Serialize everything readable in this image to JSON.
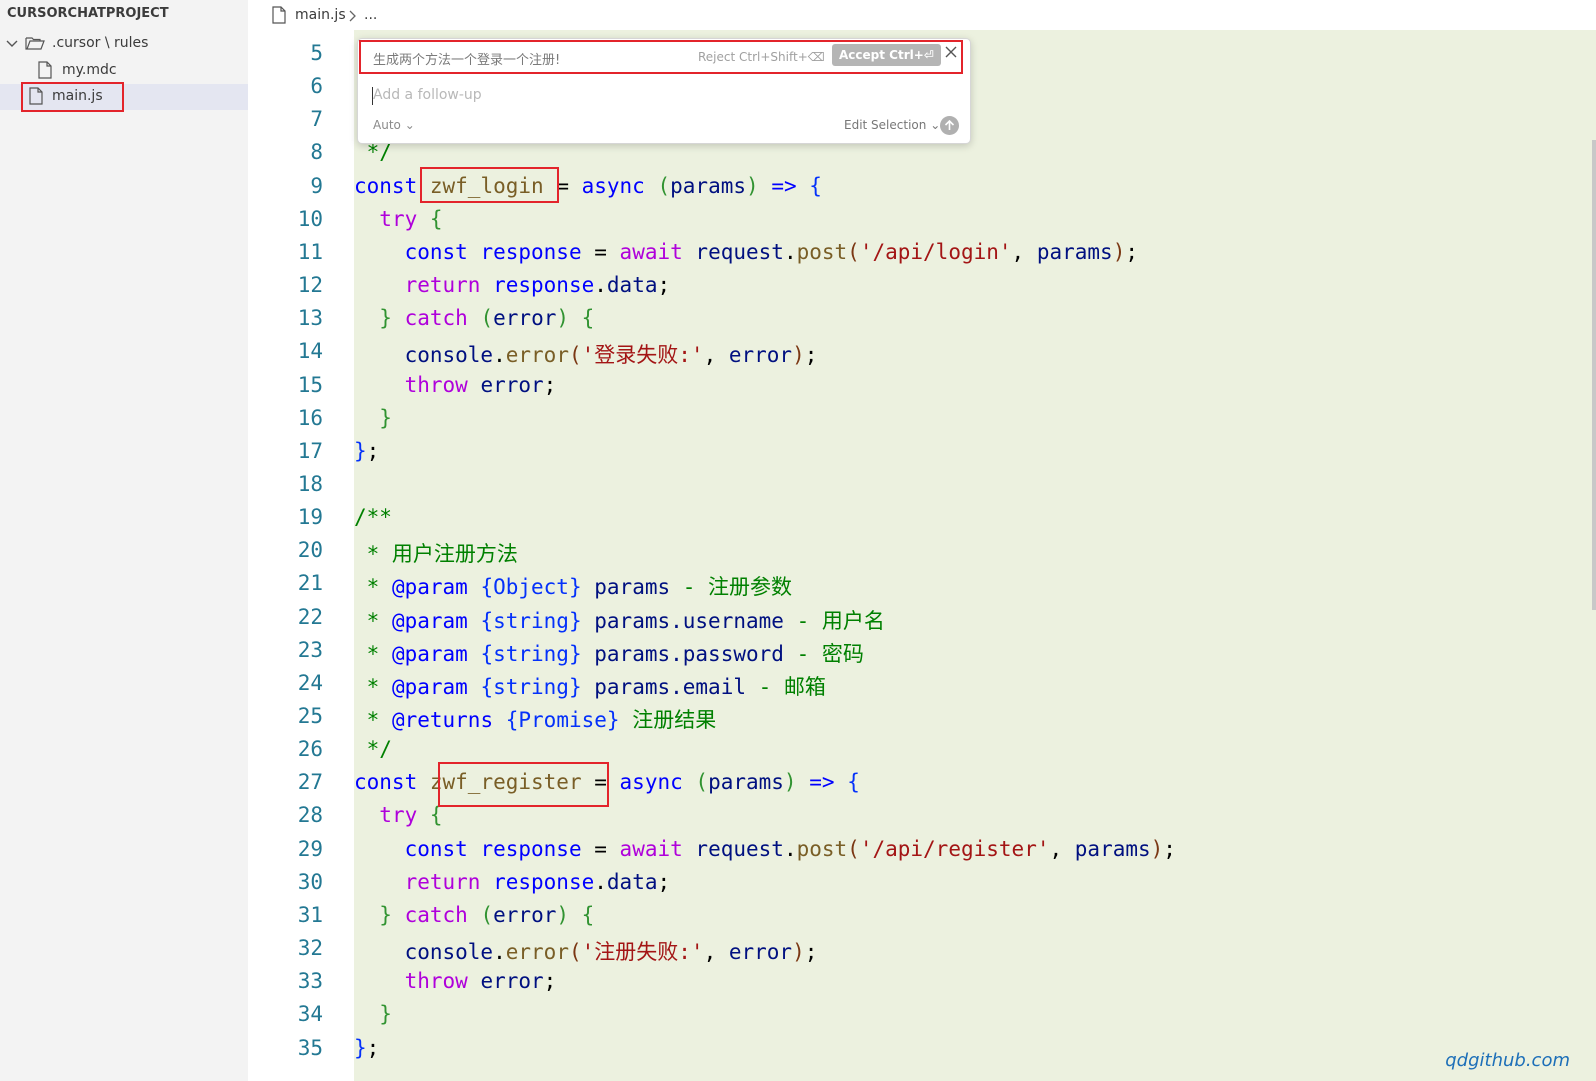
{
  "explorer": {
    "project_title": "CURSORCHATPROJECT",
    "folder_label": ".cursor \\ rules",
    "files": [
      {
        "label": "my.mdc"
      },
      {
        "label": "main.js"
      }
    ]
  },
  "tab": {
    "file_label": "main.js",
    "breadcrumb_more": "..."
  },
  "ai_widget": {
    "prompt_text": "生成两个方法一个登录一个注册!",
    "reject_label": "Reject Ctrl+Shift+⌫",
    "accept_label": "Accept Ctrl+⏎",
    "close_icon": "close-icon",
    "followup_placeholder": "Add a follow-up",
    "mode_label": "Auto",
    "edit_selection_label": "Edit Selection",
    "send_icon": "arrow-up-icon"
  },
  "code": {
    "lines": [
      {
        "n": "5",
        "segs": []
      },
      {
        "n": "6",
        "segs": []
      },
      {
        "n": "7",
        "segs": []
      },
      {
        "n": "8",
        "segs": [
          {
            "t": " */",
            "c": "cm"
          }
        ]
      },
      {
        "n": "9",
        "segs": [
          {
            "t": "const",
            "c": "kw"
          },
          {
            "t": " ",
            "c": "plain"
          },
          {
            "t": "zwf_login",
            "c": "fn"
          },
          {
            "t": " = ",
            "c": "plain"
          },
          {
            "t": "async",
            "c": "kw"
          },
          {
            "t": " ",
            "c": "plain"
          },
          {
            "t": "(",
            "c": "br2"
          },
          {
            "t": "params",
            "c": "var"
          },
          {
            "t": ")",
            "c": "br2"
          },
          {
            "t": " ",
            "c": "plain"
          },
          {
            "t": "=>",
            "c": "kw"
          },
          {
            "t": " ",
            "c": "plain"
          },
          {
            "t": "{",
            "c": "br1"
          }
        ]
      },
      {
        "n": "10",
        "segs": [
          {
            "t": "  ",
            "c": "plain"
          },
          {
            "t": "try",
            "c": "kw2"
          },
          {
            "t": " ",
            "c": "plain"
          },
          {
            "t": "{",
            "c": "br2"
          }
        ]
      },
      {
        "n": "11",
        "segs": [
          {
            "t": "    ",
            "c": "plain"
          },
          {
            "t": "const",
            "c": "kw"
          },
          {
            "t": " ",
            "c": "plain"
          },
          {
            "t": "response",
            "c": "kw"
          },
          {
            "t": " = ",
            "c": "plain"
          },
          {
            "t": "await",
            "c": "kw2"
          },
          {
            "t": " ",
            "c": "plain"
          },
          {
            "t": "request",
            "c": "var"
          },
          {
            "t": ".",
            "c": "plain"
          },
          {
            "t": "post",
            "c": "fn"
          },
          {
            "t": "(",
            "c": "br3"
          },
          {
            "t": "'/api/login'",
            "c": "str"
          },
          {
            "t": ", ",
            "c": "plain"
          },
          {
            "t": "params",
            "c": "var"
          },
          {
            "t": ")",
            "c": "br3"
          },
          {
            "t": ";",
            "c": "plain"
          }
        ]
      },
      {
        "n": "12",
        "segs": [
          {
            "t": "    ",
            "c": "plain"
          },
          {
            "t": "return",
            "c": "kw2"
          },
          {
            "t": " ",
            "c": "plain"
          },
          {
            "t": "response",
            "c": "kw"
          },
          {
            "t": ".",
            "c": "plain"
          },
          {
            "t": "data",
            "c": "var"
          },
          {
            "t": ";",
            "c": "plain"
          }
        ]
      },
      {
        "n": "13",
        "segs": [
          {
            "t": "  ",
            "c": "plain"
          },
          {
            "t": "}",
            "c": "br2"
          },
          {
            "t": " ",
            "c": "plain"
          },
          {
            "t": "catch",
            "c": "kw2"
          },
          {
            "t": " ",
            "c": "plain"
          },
          {
            "t": "(",
            "c": "br2"
          },
          {
            "t": "error",
            "c": "var"
          },
          {
            "t": ")",
            "c": "br2"
          },
          {
            "t": " ",
            "c": "plain"
          },
          {
            "t": "{",
            "c": "br2"
          }
        ]
      },
      {
        "n": "14",
        "segs": [
          {
            "t": "    ",
            "c": "plain"
          },
          {
            "t": "console",
            "c": "var"
          },
          {
            "t": ".",
            "c": "plain"
          },
          {
            "t": "error",
            "c": "fn"
          },
          {
            "t": "(",
            "c": "br3"
          },
          {
            "t": "'登录失败:'",
            "c": "str"
          },
          {
            "t": ", ",
            "c": "plain"
          },
          {
            "t": "error",
            "c": "var"
          },
          {
            "t": ")",
            "c": "br3"
          },
          {
            "t": ";",
            "c": "plain"
          }
        ]
      },
      {
        "n": "15",
        "segs": [
          {
            "t": "    ",
            "c": "plain"
          },
          {
            "t": "throw",
            "c": "kw2"
          },
          {
            "t": " ",
            "c": "plain"
          },
          {
            "t": "error",
            "c": "var"
          },
          {
            "t": ";",
            "c": "plain"
          }
        ]
      },
      {
        "n": "16",
        "segs": [
          {
            "t": "  ",
            "c": "plain"
          },
          {
            "t": "}",
            "c": "br2"
          }
        ]
      },
      {
        "n": "17",
        "segs": [
          {
            "t": "}",
            "c": "br1"
          },
          {
            "t": ";",
            "c": "plain"
          }
        ]
      },
      {
        "n": "18",
        "segs": []
      },
      {
        "n": "19",
        "segs": [
          {
            "t": "/**",
            "c": "cm"
          }
        ]
      },
      {
        "n": "20",
        "segs": [
          {
            "t": " * 用户注册方法",
            "c": "cm"
          }
        ]
      },
      {
        "n": "21",
        "segs": [
          {
            "t": " * ",
            "c": "cm"
          },
          {
            "t": "@param",
            "c": "kw"
          },
          {
            "t": " ",
            "c": "cm"
          },
          {
            "t": "{Object}",
            "c": "br1"
          },
          {
            "t": " ",
            "c": "cm"
          },
          {
            "t": "params",
            "c": "var"
          },
          {
            "t": " - 注册参数",
            "c": "cm"
          }
        ]
      },
      {
        "n": "22",
        "segs": [
          {
            "t": " * ",
            "c": "cm"
          },
          {
            "t": "@param",
            "c": "kw"
          },
          {
            "t": " ",
            "c": "cm"
          },
          {
            "t": "{string}",
            "c": "br1"
          },
          {
            "t": " ",
            "c": "cm"
          },
          {
            "t": "params.username",
            "c": "var"
          },
          {
            "t": " - 用户名",
            "c": "cm"
          }
        ]
      },
      {
        "n": "23",
        "segs": [
          {
            "t": " * ",
            "c": "cm"
          },
          {
            "t": "@param",
            "c": "kw"
          },
          {
            "t": " ",
            "c": "cm"
          },
          {
            "t": "{string}",
            "c": "br1"
          },
          {
            "t": " ",
            "c": "cm"
          },
          {
            "t": "params.password",
            "c": "var"
          },
          {
            "t": " - 密码",
            "c": "cm"
          }
        ]
      },
      {
        "n": "24",
        "segs": [
          {
            "t": " * ",
            "c": "cm"
          },
          {
            "t": "@param",
            "c": "kw"
          },
          {
            "t": " ",
            "c": "cm"
          },
          {
            "t": "{string}",
            "c": "br1"
          },
          {
            "t": " ",
            "c": "cm"
          },
          {
            "t": "params.email",
            "c": "var"
          },
          {
            "t": " - 邮箱",
            "c": "cm"
          }
        ]
      },
      {
        "n": "25",
        "segs": [
          {
            "t": " * ",
            "c": "cm"
          },
          {
            "t": "@returns",
            "c": "kw"
          },
          {
            "t": " ",
            "c": "cm"
          },
          {
            "t": "{Promise}",
            "c": "br1"
          },
          {
            "t": " 注册结果",
            "c": "cm"
          }
        ]
      },
      {
        "n": "26",
        "segs": [
          {
            "t": " */",
            "c": "cm"
          }
        ]
      },
      {
        "n": "27",
        "segs": [
          {
            "t": "const",
            "c": "kw"
          },
          {
            "t": " ",
            "c": "plain"
          },
          {
            "t": "zwf_register",
            "c": "fn"
          },
          {
            "t": " = ",
            "c": "plain"
          },
          {
            "t": "async",
            "c": "kw"
          },
          {
            "t": " ",
            "c": "plain"
          },
          {
            "t": "(",
            "c": "br2"
          },
          {
            "t": "params",
            "c": "var"
          },
          {
            "t": ")",
            "c": "br2"
          },
          {
            "t": " ",
            "c": "plain"
          },
          {
            "t": "=>",
            "c": "kw"
          },
          {
            "t": " ",
            "c": "plain"
          },
          {
            "t": "{",
            "c": "br1"
          }
        ]
      },
      {
        "n": "28",
        "segs": [
          {
            "t": "  ",
            "c": "plain"
          },
          {
            "t": "try",
            "c": "kw2"
          },
          {
            "t": " ",
            "c": "plain"
          },
          {
            "t": "{",
            "c": "br2"
          }
        ]
      },
      {
        "n": "29",
        "segs": [
          {
            "t": "    ",
            "c": "plain"
          },
          {
            "t": "const",
            "c": "kw"
          },
          {
            "t": " ",
            "c": "plain"
          },
          {
            "t": "response",
            "c": "kw"
          },
          {
            "t": " = ",
            "c": "plain"
          },
          {
            "t": "await",
            "c": "kw2"
          },
          {
            "t": " ",
            "c": "plain"
          },
          {
            "t": "request",
            "c": "var"
          },
          {
            "t": ".",
            "c": "plain"
          },
          {
            "t": "post",
            "c": "fn"
          },
          {
            "t": "(",
            "c": "br3"
          },
          {
            "t": "'/api/register'",
            "c": "str"
          },
          {
            "t": ", ",
            "c": "plain"
          },
          {
            "t": "params",
            "c": "var"
          },
          {
            "t": ")",
            "c": "br3"
          },
          {
            "t": ";",
            "c": "plain"
          }
        ]
      },
      {
        "n": "30",
        "segs": [
          {
            "t": "    ",
            "c": "plain"
          },
          {
            "t": "return",
            "c": "kw2"
          },
          {
            "t": " ",
            "c": "plain"
          },
          {
            "t": "response",
            "c": "kw"
          },
          {
            "t": ".",
            "c": "plain"
          },
          {
            "t": "data",
            "c": "var"
          },
          {
            "t": ";",
            "c": "plain"
          }
        ]
      },
      {
        "n": "31",
        "segs": [
          {
            "t": "  ",
            "c": "plain"
          },
          {
            "t": "}",
            "c": "br2"
          },
          {
            "t": " ",
            "c": "plain"
          },
          {
            "t": "catch",
            "c": "kw2"
          },
          {
            "t": " ",
            "c": "plain"
          },
          {
            "t": "(",
            "c": "br2"
          },
          {
            "t": "error",
            "c": "var"
          },
          {
            "t": ")",
            "c": "br2"
          },
          {
            "t": " ",
            "c": "plain"
          },
          {
            "t": "{",
            "c": "br2"
          }
        ]
      },
      {
        "n": "32",
        "segs": [
          {
            "t": "    ",
            "c": "plain"
          },
          {
            "t": "console",
            "c": "var"
          },
          {
            "t": ".",
            "c": "plain"
          },
          {
            "t": "error",
            "c": "fn"
          },
          {
            "t": "(",
            "c": "br3"
          },
          {
            "t": "'注册失败:'",
            "c": "str"
          },
          {
            "t": ", ",
            "c": "plain"
          },
          {
            "t": "error",
            "c": "var"
          },
          {
            "t": ")",
            "c": "br3"
          },
          {
            "t": ";",
            "c": "plain"
          }
        ]
      },
      {
        "n": "33",
        "segs": [
          {
            "t": "    ",
            "c": "plain"
          },
          {
            "t": "throw",
            "c": "kw2"
          },
          {
            "t": " ",
            "c": "plain"
          },
          {
            "t": "error",
            "c": "var"
          },
          {
            "t": ";",
            "c": "plain"
          }
        ]
      },
      {
        "n": "34",
        "segs": [
          {
            "t": "  ",
            "c": "plain"
          },
          {
            "t": "}",
            "c": "br2"
          }
        ]
      },
      {
        "n": "35",
        "segs": [
          {
            "t": "}",
            "c": "br1"
          },
          {
            "t": ";",
            "c": "plain"
          }
        ]
      }
    ]
  },
  "watermark": "qdgithub.com",
  "colors": {
    "highlight_box": "#e3242b",
    "code_background": "#ecf1df",
    "line_number": "#237893"
  }
}
